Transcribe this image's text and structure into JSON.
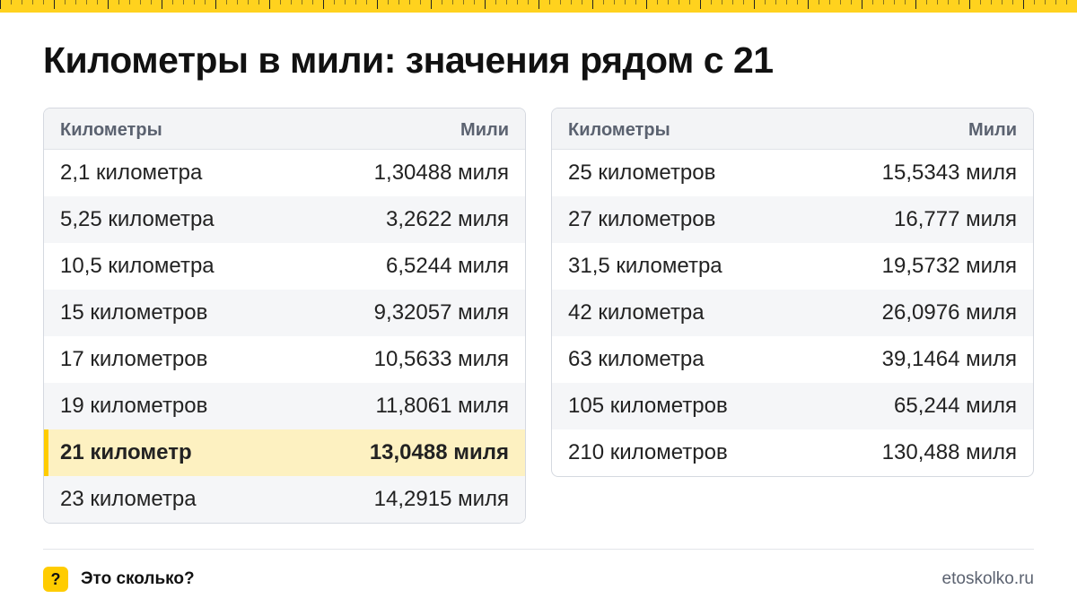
{
  "title": "Километры в мили: значения рядом с 21",
  "left_table": {
    "headers": [
      "Километры",
      "Мили"
    ],
    "rows": [
      {
        "km": "2,1 километра",
        "mi": "1,30488 миля",
        "highlight": false
      },
      {
        "km": "5,25 километра",
        "mi": "3,2622 миля",
        "highlight": false
      },
      {
        "km": "10,5 километра",
        "mi": "6,5244 миля",
        "highlight": false
      },
      {
        "km": "15 километров",
        "mi": "9,32057 миля",
        "highlight": false
      },
      {
        "km": "17 километров",
        "mi": "10,5633 миля",
        "highlight": false
      },
      {
        "km": "19 километров",
        "mi": "11,8061 миля",
        "highlight": false
      },
      {
        "km": "21 километр",
        "mi": "13,0488 миля",
        "highlight": true
      },
      {
        "km": "23 километра",
        "mi": "14,2915 миля",
        "highlight": false
      }
    ]
  },
  "right_table": {
    "headers": [
      "Километры",
      "Мили"
    ],
    "rows": [
      {
        "km": "25 километров",
        "mi": "15,5343 миля",
        "highlight": false
      },
      {
        "km": "27 километров",
        "mi": "16,777 миля",
        "highlight": false
      },
      {
        "km": "31,5 километра",
        "mi": "19,5732 миля",
        "highlight": false
      },
      {
        "km": "42 километра",
        "mi": "26,0976 миля",
        "highlight": false
      },
      {
        "km": "63 километра",
        "mi": "39,1464 миля",
        "highlight": false
      },
      {
        "km": "105 километров",
        "mi": "65,244 миля",
        "highlight": false
      },
      {
        "km": "210 километров",
        "mi": "130,488 миля",
        "highlight": false
      }
    ]
  },
  "footer": {
    "brand_icon": "?",
    "brand_name": "Это сколько?",
    "site": "etoskolko.ru"
  },
  "colors": {
    "accent": "#ffcc00",
    "highlight_row": "#fdf1c1",
    "ruler": "#ffd21e"
  },
  "icons": {
    "brand": "question-mark-icon"
  }
}
